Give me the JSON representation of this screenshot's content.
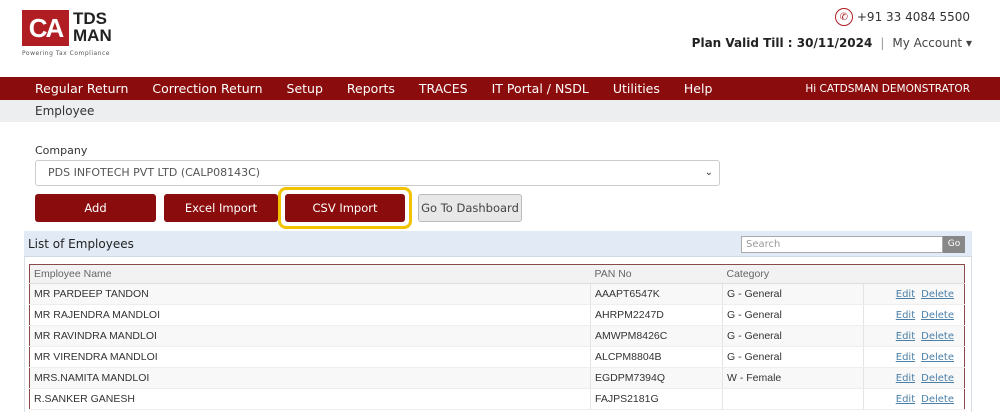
{
  "logo": {
    "mark": "CA",
    "name_line1": "TDS",
    "name_line2": "MAN",
    "tagline": "Powering Tax Compliance"
  },
  "header": {
    "phone": "+91 33 4084 5500",
    "plan_valid": "Plan Valid Till : 30/11/2024",
    "separator": "|",
    "my_account": "My Account"
  },
  "nav": {
    "items": [
      "Regular Return",
      "Correction Return",
      "Setup",
      "Reports",
      "TRACES",
      "IT Portal / NSDL",
      "Utilities",
      "Help"
    ],
    "greeting": "Hi CATDSMAN DEMONSTRATOR"
  },
  "breadcrumb": "Employee",
  "company": {
    "label": "Company",
    "value": "PDS INFOTECH PVT LTD (CALP08143C)"
  },
  "buttons": {
    "add": "Add",
    "excel": "Excel Import",
    "csv": "CSV Import",
    "dashboard": "Go To Dashboard"
  },
  "list": {
    "title": "List of Employees",
    "search_placeholder": "Search",
    "go": "Go",
    "columns": [
      "Employee Name",
      "PAN No",
      "Category",
      ""
    ],
    "edit": "Edit",
    "delete": "Delete",
    "rows": [
      {
        "name": "MR PARDEEP TANDON",
        "pan": "AAAPT6547K",
        "category": "G - General"
      },
      {
        "name": "MR RAJENDRA MANDLOI",
        "pan": "AHRPM2247D",
        "category": "G - General"
      },
      {
        "name": "MR RAVINDRA MANDLOI",
        "pan": "AMWPM8426C",
        "category": "G - General"
      },
      {
        "name": "MR VIRENDRA MANDLOI",
        "pan": "ALCPM8804B",
        "category": "G - General"
      },
      {
        "name": "MRS.NAMITA MANDLOI",
        "pan": "EGDPM7394Q",
        "category": "W - Female"
      },
      {
        "name": "R.SANKER GANESH",
        "pan": "FAJPS2181G",
        "category": ""
      }
    ]
  }
}
